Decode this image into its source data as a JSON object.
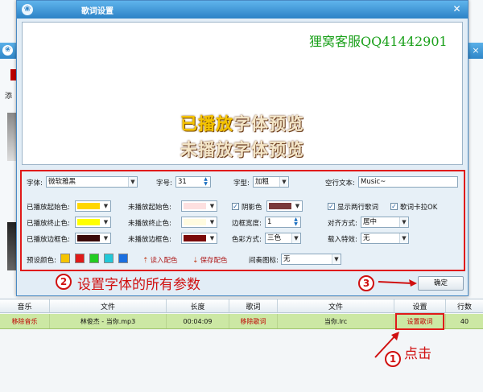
{
  "dialog": {
    "title": "歌词设置",
    "icon": "app-logo-icon",
    "close_label": "✕",
    "ok_label": "确定",
    "watermark": "狸窝客服QQ41442901",
    "preview": {
      "played_part": "已播放",
      "unplayed_part": "字体预览",
      "unplayed_line": "未播放字体预览",
      "played_color": "#f5c400",
      "unplayed_color": "#f4e6c8"
    },
    "settings": {
      "font_label": "字体:",
      "font_value": "微软雅黑",
      "size_label": "字号:",
      "size_value": "31",
      "style_label": "字型:",
      "style_value": "加粗",
      "blank_text_label": "空行文本:",
      "blank_text_value": "Music~",
      "played_start_label": "已播放起始色:",
      "played_start_color": "#ffd700",
      "unplayed_start_label": "未播放起始色:",
      "unplayed_start_color": "#fde0e0",
      "shadow_label": "阴影色",
      "shadow_checked": true,
      "shadow_color": "#7a3a3a",
      "two_lines_label": "显示两行歌词",
      "two_lines_checked": true,
      "karaoke_label": "歌词卡拉OK",
      "karaoke_checked": true,
      "played_end_label": "已播放终止色:",
      "played_end_color": "#ffff00",
      "unplayed_end_label": "未播放终止色:",
      "unplayed_end_color": "#fffbe0",
      "border_width_label": "边框宽度:",
      "border_width_value": "1",
      "align_label": "对齐方式:",
      "align_value": "居中",
      "played_border_label": "已播放边框色:",
      "played_border_color": "#3a0a0a",
      "unplayed_border_label": "未播放边框色:",
      "unplayed_border_color": "#7a0a0a",
      "color_mode_label": "色彩方式:",
      "color_mode_value": "三色",
      "load_effect_label": "载入特效:",
      "load_effect_value": "无",
      "preset_label": "预设颜色:",
      "preset_colors": [
        "#f5c400",
        "#e01a1a",
        "#22cc22",
        "#22c8d8",
        "#1a6fe0"
      ],
      "load_preset_label": "读入配色",
      "save_preset_label": "保存配色",
      "interlude_icon_label": "间奏图标:",
      "interlude_icon_value": "无"
    }
  },
  "table": {
    "headers": [
      "音乐",
      "文件",
      "长度",
      "歌词",
      "文件",
      "设置",
      "行数"
    ],
    "row": {
      "remove_music": "移除音乐",
      "file": "林俊杰 - 当你.mp3",
      "length": "00:04:09",
      "remove_lyric": "移除歌词",
      "lyric_file": "当你.lrc",
      "setting": "设置歌词",
      "lines": "40"
    }
  },
  "background_app": {
    "add_label": "添"
  },
  "annotations": {
    "step1": "1",
    "step1_text": "点击",
    "step2": "2",
    "step2_text": "设置字体的所有参数",
    "step3": "3"
  }
}
